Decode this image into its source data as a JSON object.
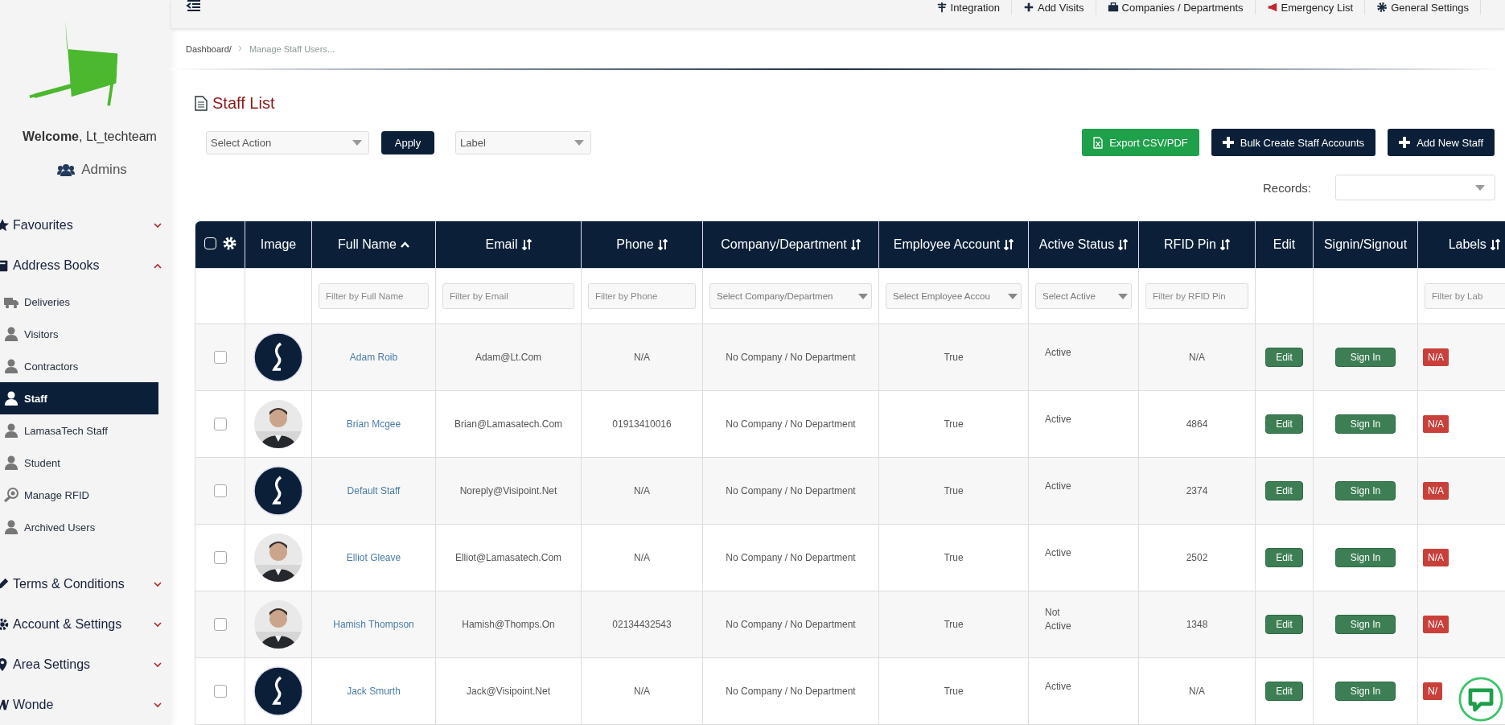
{
  "sidebar": {
    "welcome": "**Welcome**, Lt_techteam",
    "role": "Admins",
    "sections": [
      {
        "label": "Favourites",
        "expanded": false
      },
      {
        "label": "Address Books",
        "expanded": true,
        "children": [
          {
            "label": "Deliveries",
            "selected": false
          },
          {
            "label": "Visitors",
            "selected": false
          },
          {
            "label": "Contractors",
            "selected": false
          },
          {
            "label": "Staff",
            "selected": true
          },
          {
            "label": "LamasaTech Staff",
            "selected": false
          },
          {
            "label": "Student",
            "selected": false
          },
          {
            "label": "Manage RFID",
            "selected": false
          },
          {
            "label": "Archived Users",
            "selected": false
          }
        ]
      },
      {
        "label": "Terms & Conditions",
        "expanded": false
      },
      {
        "label": "Account & Settings",
        "expanded": false
      },
      {
        "label": "Area Settings",
        "expanded": false
      },
      {
        "label": "Wonde",
        "expanded": false
      }
    ]
  },
  "top_nav": [
    "Integration",
    "Add Visits",
    "Companies / Departments",
    "Emergency List",
    "General Settings"
  ],
  "breadcrumb": [
    "Dashboard/",
    "Manage Staff Users..."
  ],
  "title": "Staff List",
  "toolbar": {
    "action_select": "Select Action",
    "apply": "Apply",
    "label_select": "Label",
    "buttons": [
      {
        "label": "Export CSV/PDF",
        "kind": "export"
      },
      {
        "label": "Bulk Create Staff Accounts",
        "kind": "add"
      },
      {
        "label": "Add New Staff",
        "kind": "add"
      }
    ],
    "records_label": "Records:"
  },
  "table": {
    "select_all": {
      "checked": false
    },
    "columns": [
      {
        "label": "Image",
        "sortable": false,
        "sorted_ascending": false
      },
      {
        "label": "Full Name",
        "sortable": true,
        "sorted_ascending": true,
        "filter": {
          "kind": "text",
          "placeholder": "Filter by Full Name"
        }
      },
      {
        "label": "Email",
        "sortable": true,
        "sorted_ascending": false,
        "filter": {
          "kind": "text",
          "placeholder": "Filter by Email"
        }
      },
      {
        "label": "Phone",
        "sortable": true,
        "sorted_ascending": false,
        "filter": {
          "kind": "text",
          "placeholder": "Filter by Phone"
        }
      },
      {
        "label": "Company/Department",
        "sortable": true,
        "sorted_ascending": false,
        "filter": {
          "kind": "select",
          "placeholder": "Select Company/Departmen"
        }
      },
      {
        "label": "Employee Account",
        "sortable": true,
        "sorted_ascending": false,
        "filter": {
          "kind": "select",
          "placeholder": "Select Employee Accou"
        }
      },
      {
        "label": "Active Status",
        "sortable": true,
        "sorted_ascending": false,
        "filter": {
          "kind": "select",
          "placeholder": "Select Active"
        }
      },
      {
        "label": "RFID Pin",
        "sortable": true,
        "sorted_ascending": false,
        "filter": {
          "kind": "text",
          "placeholder": "Filter by RFID Pin"
        }
      },
      {
        "label": "Edit",
        "sortable": false,
        "sorted_ascending": false
      },
      {
        "label": "Signin/Signout",
        "sortable": false,
        "sorted_ascending": false
      },
      {
        "label": "Labels",
        "sortable": true,
        "sorted_ascending": false,
        "filter": {
          "kind": "text",
          "placeholder": "Filter by Lab"
        }
      }
    ],
    "rows": [
      {
        "checked": false,
        "kind": "logo",
        "name": "Adam Roib",
        "email": "Adam@Lt.Com",
        "phone": "N/A",
        "company": "No Company / No Department",
        "employee": "True",
        "status": "Active",
        "rfid": "N/A",
        "edit": "Edit",
        "sign": "Sign In",
        "label": "N/A"
      },
      {
        "checked": false,
        "name": "Brian Mcgee",
        "email": "Brian@Lamasatech.Com",
        "phone": "01913410016",
        "company": "No Company / No Department",
        "employee": "True",
        "status": "Active",
        "rfid": "4864",
        "edit": "Edit",
        "sign": "Sign In",
        "label": "N/A"
      },
      {
        "checked": false,
        "kind": "logo",
        "name": "Default Staff",
        "email": "Noreply@Visipoint.Net",
        "phone": "N/A",
        "company": "No Company / No Department",
        "employee": "True",
        "status": "Active",
        "rfid": "2374",
        "edit": "Edit",
        "sign": "Sign In",
        "label": "N/A"
      },
      {
        "checked": false,
        "name": "Elliot Gleave",
        "email": "Elliot@Lamasatech.Com",
        "phone": "N/A",
        "company": "No Company / No Department",
        "employee": "True",
        "status": "Active",
        "rfid": "2502",
        "edit": "Edit",
        "sign": "Sign In",
        "label": "N/A"
      },
      {
        "checked": false,
        "name": "Hamish Thompson",
        "email": "Hamish@Thomps.On",
        "phone": "02134432543",
        "company": "No Company / No Department",
        "employee": "True",
        "status": "Not Active",
        "rfid": "1348",
        "edit": "Edit",
        "sign": "Sign In",
        "label": "N/A"
      },
      {
        "checked": false,
        "kind": "logo",
        "name": "Jack Smurth",
        "email": "Jack@Visipoint.Net",
        "phone": "N/A",
        "company": "No Company / No Department",
        "employee": "True",
        "status": "Active",
        "rfid": "N/A",
        "edit": "Edit",
        "sign": "Sign In",
        "label": "N/"
      }
    ]
  }
}
